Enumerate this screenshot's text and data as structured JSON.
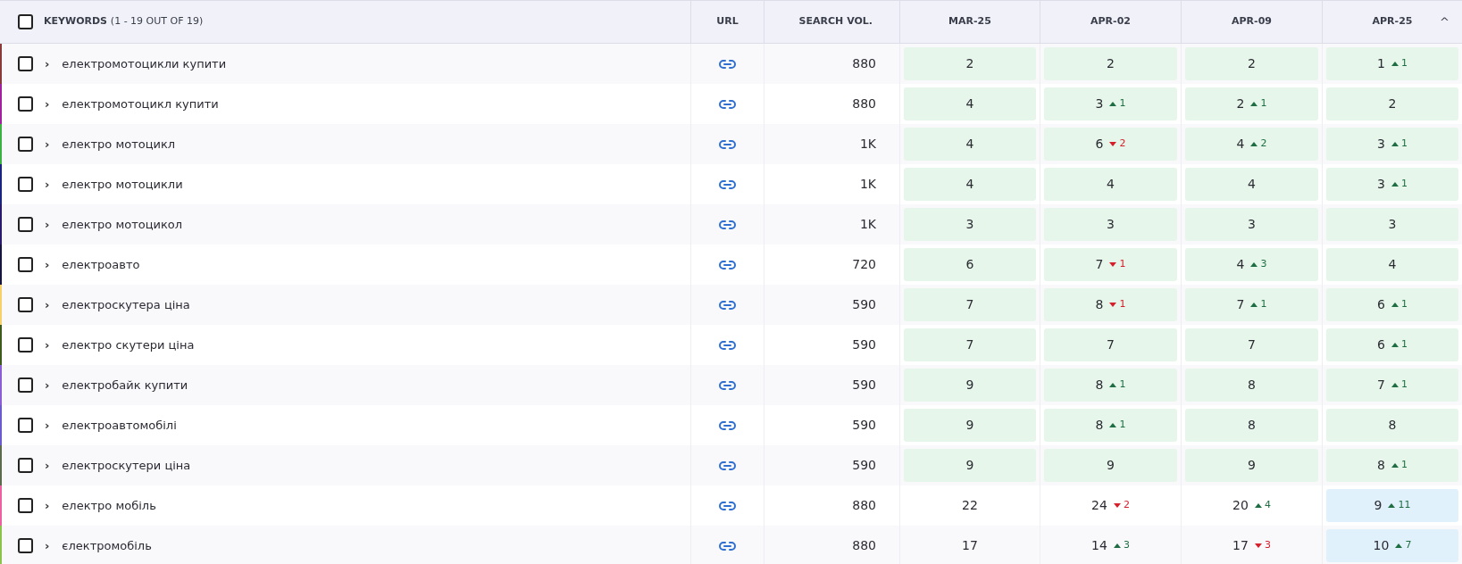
{
  "header": {
    "keywords_label": "KEYWORDS",
    "keywords_count": "(1 - 19 OUT OF 19)",
    "select_all_checked": false,
    "url": "URL",
    "search_volume": "SEARCH VOL.",
    "dates": [
      "MAR-25",
      "APR-02",
      "APR-09",
      "APR-25"
    ],
    "sort_icon": "^"
  },
  "rows": [
    {
      "color": "#8b3a3a",
      "checked": false,
      "expand": "›",
      "keyword": "електромотоцикли купити",
      "volume": "880",
      "cells": [
        {
          "value": "2",
          "kind": "top"
        },
        {
          "value": "2",
          "kind": "top"
        },
        {
          "value": "2",
          "kind": "top"
        },
        {
          "value": "1",
          "kind": "top",
          "change": {
            "up": true,
            "amount": "1"
          }
        }
      ]
    },
    {
      "color": "#a020a0",
      "checked": false,
      "expand": "›",
      "keyword": "електромотоцикл купити",
      "volume": "880",
      "cells": [
        {
          "value": "4",
          "kind": "top"
        },
        {
          "value": "3",
          "kind": "top",
          "change": {
            "up": true,
            "amount": "1"
          }
        },
        {
          "value": "2",
          "kind": "top",
          "change": {
            "up": true,
            "amount": "1"
          }
        },
        {
          "value": "2",
          "kind": "top"
        }
      ]
    },
    {
      "color": "#3cb043",
      "checked": false,
      "expand": "›",
      "keyword": "електро мотоцикл",
      "volume": "1K",
      "cells": [
        {
          "value": "4",
          "kind": "top"
        },
        {
          "value": "6",
          "kind": "top",
          "change": {
            "up": false,
            "amount": "2"
          }
        },
        {
          "value": "4",
          "kind": "top",
          "change": {
            "up": true,
            "amount": "2"
          }
        },
        {
          "value": "3",
          "kind": "top",
          "change": {
            "up": true,
            "amount": "1"
          }
        }
      ]
    },
    {
      "color": "#1a237e",
      "checked": false,
      "expand": "›",
      "keyword": "електро мотоцикли",
      "volume": "1K",
      "cells": [
        {
          "value": "4",
          "kind": "top"
        },
        {
          "value": "4",
          "kind": "top"
        },
        {
          "value": "4",
          "kind": "top"
        },
        {
          "value": "3",
          "kind": "top",
          "change": {
            "up": true,
            "amount": "1"
          }
        }
      ]
    },
    {
      "color": "#2a1a6e",
      "checked": false,
      "expand": "›",
      "keyword": "електро мотоцикол",
      "volume": "1K",
      "cells": [
        {
          "value": "3",
          "kind": "top"
        },
        {
          "value": "3",
          "kind": "top"
        },
        {
          "value": "3",
          "kind": "top"
        },
        {
          "value": "3",
          "kind": "top"
        }
      ]
    },
    {
      "color": "#14143c",
      "checked": false,
      "expand": "›",
      "keyword": "електроавто",
      "volume": "720",
      "cells": [
        {
          "value": "6",
          "kind": "top"
        },
        {
          "value": "7",
          "kind": "top",
          "change": {
            "up": false,
            "amount": "1"
          }
        },
        {
          "value": "4",
          "kind": "top",
          "change": {
            "up": true,
            "amount": "3"
          }
        },
        {
          "value": "4",
          "kind": "top"
        }
      ]
    },
    {
      "color": "#f5d06b",
      "checked": false,
      "expand": "›",
      "keyword": "електроскутера ціна",
      "volume": "590",
      "cells": [
        {
          "value": "7",
          "kind": "top"
        },
        {
          "value": "8",
          "kind": "top",
          "change": {
            "up": false,
            "amount": "1"
          }
        },
        {
          "value": "7",
          "kind": "top",
          "change": {
            "up": true,
            "amount": "1"
          }
        },
        {
          "value": "6",
          "kind": "top",
          "change": {
            "up": true,
            "amount": "1"
          }
        }
      ]
    },
    {
      "color": "#3d5a1a",
      "checked": false,
      "expand": "›",
      "keyword": "електро скутери ціна",
      "volume": "590",
      "cells": [
        {
          "value": "7",
          "kind": "top"
        },
        {
          "value": "7",
          "kind": "top"
        },
        {
          "value": "7",
          "kind": "top"
        },
        {
          "value": "6",
          "kind": "top",
          "change": {
            "up": true,
            "amount": "1"
          }
        }
      ]
    },
    {
      "color": "#8a5cd6",
      "checked": false,
      "expand": "›",
      "keyword": "електробайк купити",
      "volume": "590",
      "cells": [
        {
          "value": "9",
          "kind": "top"
        },
        {
          "value": "8",
          "kind": "top",
          "change": {
            "up": true,
            "amount": "1"
          }
        },
        {
          "value": "8",
          "kind": "top"
        },
        {
          "value": "7",
          "kind": "top",
          "change": {
            "up": true,
            "amount": "1"
          }
        }
      ]
    },
    {
      "color": "#6a5acd",
      "checked": false,
      "expand": "›",
      "keyword": "електроавтомобілі",
      "volume": "590",
      "cells": [
        {
          "value": "9",
          "kind": "top"
        },
        {
          "value": "8",
          "kind": "top",
          "change": {
            "up": true,
            "amount": "1"
          }
        },
        {
          "value": "8",
          "kind": "top"
        },
        {
          "value": "8",
          "kind": "top"
        }
      ]
    },
    {
      "color": "#5b6b4b",
      "checked": false,
      "expand": "›",
      "keyword": "електроскутери ціна",
      "volume": "590",
      "cells": [
        {
          "value": "9",
          "kind": "top"
        },
        {
          "value": "9",
          "kind": "top"
        },
        {
          "value": "9",
          "kind": "top"
        },
        {
          "value": "8",
          "kind": "top",
          "change": {
            "up": true,
            "amount": "1"
          }
        }
      ]
    },
    {
      "color": "#ec5fa0",
      "checked": false,
      "expand": "›",
      "keyword": "електро мобіль",
      "volume": "880",
      "cells": [
        {
          "value": "22",
          "kind": "plain"
        },
        {
          "value": "24",
          "kind": "plain",
          "change": {
            "up": false,
            "amount": "2"
          }
        },
        {
          "value": "20",
          "kind": "plain",
          "change": {
            "up": true,
            "amount": "4"
          }
        },
        {
          "value": "9",
          "kind": "entered",
          "change": {
            "up": true,
            "amount": "11"
          }
        }
      ]
    },
    {
      "color": "#8bc34a",
      "checked": false,
      "expand": "›",
      "keyword": "єлектромобіль",
      "volume": "880",
      "cells": [
        {
          "value": "17",
          "kind": "plain"
        },
        {
          "value": "14",
          "kind": "plain",
          "change": {
            "up": true,
            "amount": "3"
          }
        },
        {
          "value": "17",
          "kind": "plain",
          "change": {
            "up": false,
            "amount": "3"
          }
        },
        {
          "value": "10",
          "kind": "entered",
          "change": {
            "up": true,
            "amount": "7"
          }
        }
      ]
    }
  ]
}
